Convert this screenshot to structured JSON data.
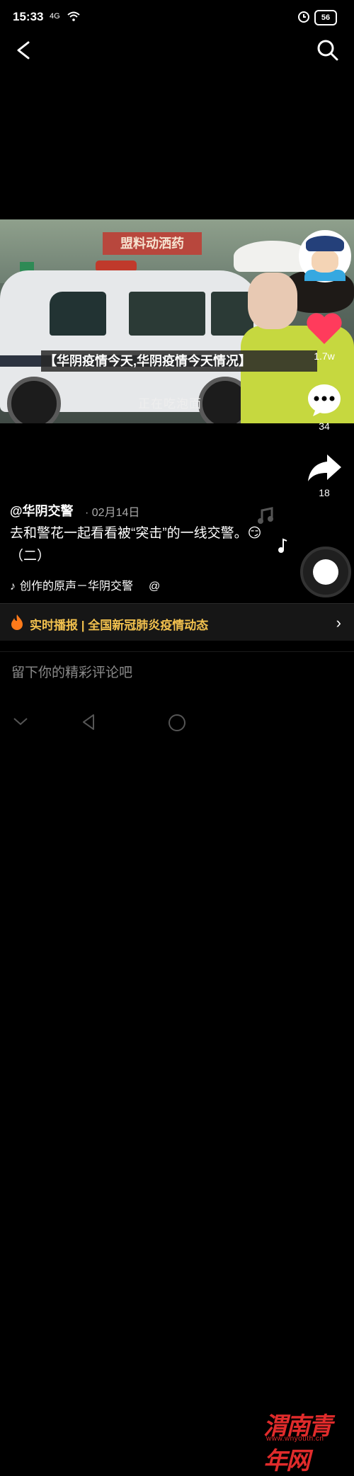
{
  "status_bar": {
    "time": "15:33",
    "network": "4G",
    "battery": "56"
  },
  "video": {
    "sign_text": "盟料动洒药",
    "caption": "正在吃泡面",
    "title_overlay": "【华阴疫情今天,华阴疫情今天情况】"
  },
  "actions": {
    "likes": "1.7w",
    "comments": "34",
    "shares": "18"
  },
  "post": {
    "author": "@华阴交警",
    "date": "· 02月14日",
    "description": "去和警花一起看看被“突击”的一线交警。😏（二）",
    "music": "创作的原声－华阴交警",
    "music_at": "@"
  },
  "banner": {
    "label": "实时播报 | 全国新冠肺炎疫情动态"
  },
  "comment": {
    "placeholder": "留下你的精彩评论吧"
  },
  "watermark": {
    "text": "渭南青年网",
    "url": "www.wnyouth.cn"
  },
  "colors": {
    "like_red": "#ff3b5c",
    "banner_gold": "#f2c14e",
    "watermark_red": "#e02b2b"
  }
}
